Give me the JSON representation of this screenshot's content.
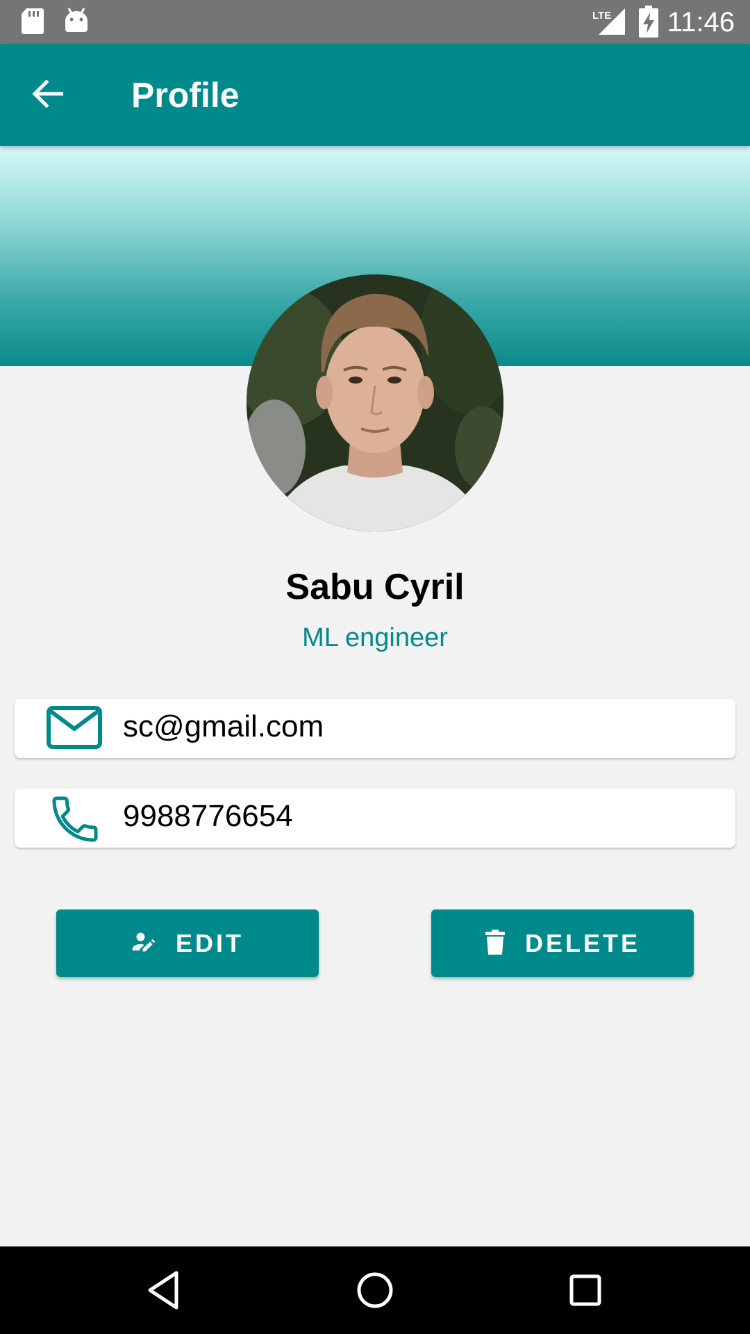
{
  "status_bar": {
    "time": "11:46",
    "icons": [
      "sd-card-icon",
      "android-icon",
      "lte-signal-icon",
      "battery-charging-icon"
    ]
  },
  "app_bar": {
    "title": "Profile",
    "back_icon": "arrow-back-icon"
  },
  "profile": {
    "name": "Sabu Cyril",
    "role": "ML engineer",
    "avatar_icon": "profile-photo"
  },
  "contact": {
    "email": "sc@gmail.com",
    "email_icon": "mail-icon",
    "phone": "9988776654",
    "phone_icon": "phone-icon"
  },
  "actions": {
    "edit_label": "EDIT",
    "edit_icon": "edit-person-icon",
    "delete_label": "DELETE",
    "delete_icon": "trash-icon"
  },
  "nav_bar": {
    "buttons": [
      "back-triangle-icon",
      "home-circle-icon",
      "recents-square-icon"
    ]
  },
  "colors": {
    "primary": "#00898a",
    "status_bar": "#757575",
    "background": "#f2f2f2"
  }
}
